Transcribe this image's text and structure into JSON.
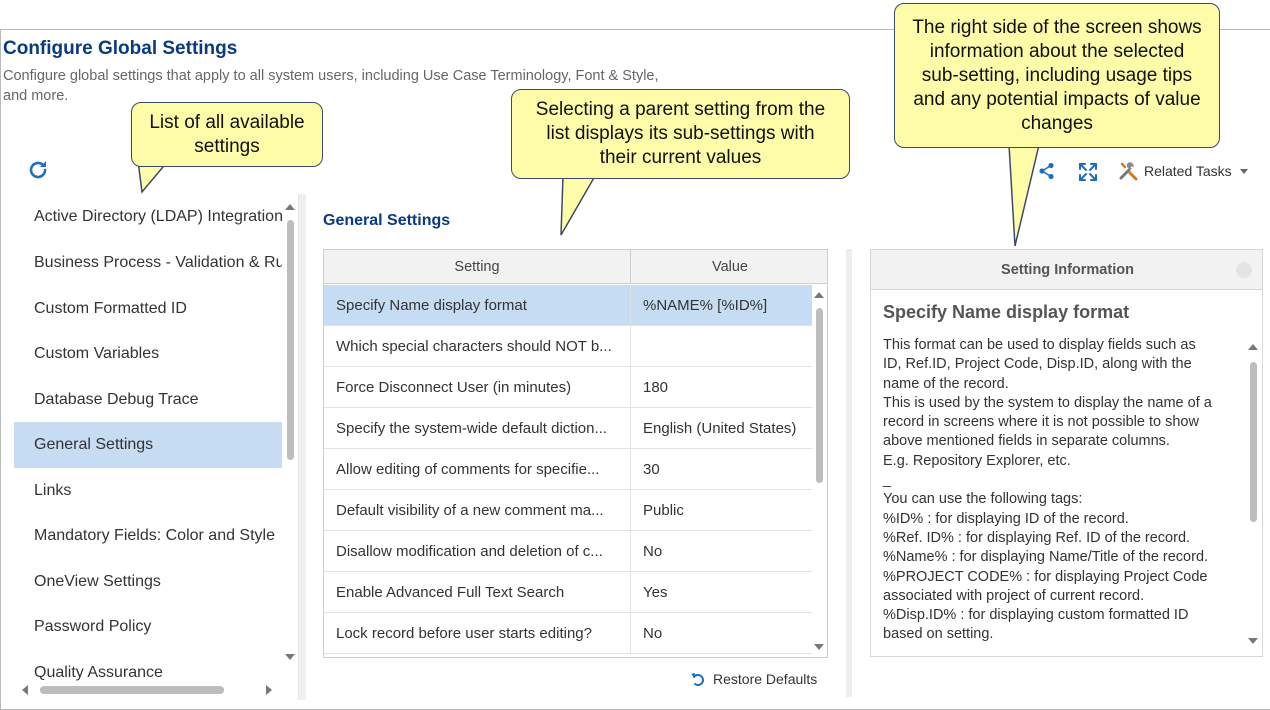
{
  "page": {
    "title": "Configure Global Settings",
    "description": "Configure global settings that apply to all system users, including Use Case Terminology, Font & Style, and more."
  },
  "toolbar": {
    "refresh_icon": "refresh-icon",
    "share_icon": "share-icon",
    "expand_icon": "fullscreen-icon",
    "related_tasks_label": "Related Tasks"
  },
  "settings_list": {
    "items": [
      {
        "label": "Active Directory (LDAP) Integration"
      },
      {
        "label": "Business Process - Validation & Rules"
      },
      {
        "label": "Custom Formatted ID"
      },
      {
        "label": "Custom Variables"
      },
      {
        "label": "Database Debug Trace"
      },
      {
        "label": "General Settings"
      },
      {
        "label": "Links"
      },
      {
        "label": "Mandatory Fields: Color and Style"
      },
      {
        "label": "OneView Settings"
      },
      {
        "label": "Password Policy"
      },
      {
        "label": "Quality Assurance"
      }
    ],
    "selected_index": 5
  },
  "general": {
    "section_title": "General Settings",
    "columns": [
      "Setting",
      "Value"
    ],
    "rows": [
      {
        "setting": "Specify Name display format",
        "value": "%NAME% [%ID%]"
      },
      {
        "setting": "Which special characters should NOT b...",
        "value": ""
      },
      {
        "setting": "Force Disconnect User (in minutes)",
        "value": "180"
      },
      {
        "setting": "Specify the system-wide default diction...",
        "value": "English (United States)"
      },
      {
        "setting": "Allow editing of comments for specifie...",
        "value": "30"
      },
      {
        "setting": "Default visibility of a new comment ma...",
        "value": "Public"
      },
      {
        "setting": "Disallow modification and deletion of c...",
        "value": "No"
      },
      {
        "setting": "Enable Advanced Full Text Search",
        "value": "Yes"
      },
      {
        "setting": "Lock record before user starts editing?",
        "value": "No"
      }
    ],
    "selected_row": 0,
    "restore_label": "Restore Defaults"
  },
  "info": {
    "header": "Setting Information",
    "title": "Specify Name display format",
    "lines": [
      "This format can be used to display fields such as",
      "ID, Ref.ID, Project Code, Disp.ID, along with the",
      "name of the record.",
      "This is used by the system to display the name of a",
      "record in screens where it is not possible to show",
      "above mentioned fields in separate columns.",
      "E.g. Repository Explorer, etc.",
      "_",
      "You can use the following tags:",
      "%ID% : for displaying ID of the record.",
      "%Ref. ID% : for displaying Ref. ID of the record.",
      "%Name% : for displaying Name/Title of the record.",
      "%PROJECT CODE% : for displaying Project Code",
      "associated with project of current record.",
      "%Disp.ID% : for displaying custom formatted ID",
      "based on setting."
    ]
  },
  "callouts": {
    "list": "List of all available settings",
    "subsettings": "Selecting a parent setting from the list displays its sub-settings with their current values",
    "info": "The right side of the screen shows information about the selected sub-setting, including usage tips and any potential impacts of value changes"
  },
  "colors": {
    "title": "#0b3a80",
    "selection": "#c5dcf2",
    "callout_fill": "#fefca8",
    "icon_blue": "#1f6fbf"
  }
}
